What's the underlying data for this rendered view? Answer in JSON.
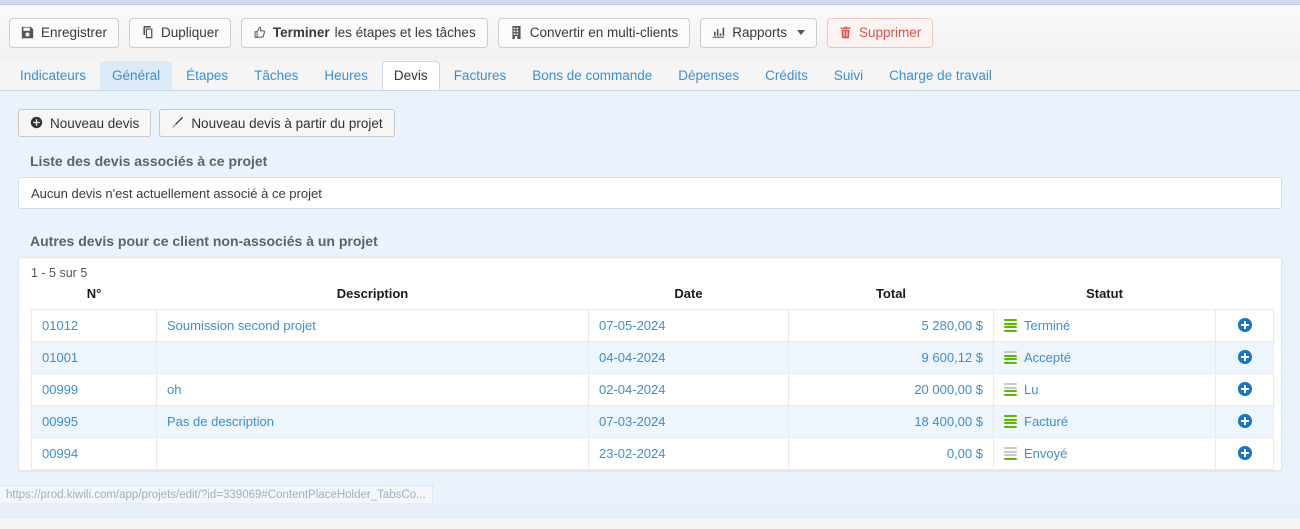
{
  "toolbar": {
    "buttons": [
      {
        "label": "Enregistrer",
        "icon": "save-icon",
        "style": "default"
      },
      {
        "label": "Dupliquer",
        "icon": "copy-icon",
        "style": "default"
      },
      {
        "label": "Terminer",
        "label2": "les étapes et les tâches",
        "icon": "thumbs-up-icon",
        "style": "default"
      },
      {
        "label": "Convertir en multi-clients",
        "icon": "building-icon",
        "style": "default"
      },
      {
        "label": "Rapports",
        "icon": "bar-chart-icon",
        "style": "default",
        "caret": true
      },
      {
        "label": "Supprimer",
        "icon": "trash-icon",
        "style": "danger"
      }
    ]
  },
  "tabs": [
    {
      "label": "Indicateurs",
      "state": "normal"
    },
    {
      "label": "Général",
      "state": "soft"
    },
    {
      "label": "Étapes",
      "state": "normal"
    },
    {
      "label": "Tâches",
      "state": "normal"
    },
    {
      "label": "Heures",
      "state": "normal"
    },
    {
      "label": "Devis",
      "state": "active"
    },
    {
      "label": "Factures",
      "state": "normal"
    },
    {
      "label": "Bons de commande",
      "state": "normal"
    },
    {
      "label": "Dépenses",
      "state": "normal"
    },
    {
      "label": "Crédits",
      "state": "normal"
    },
    {
      "label": "Suivi",
      "state": "normal"
    },
    {
      "label": "Charge de travail",
      "state": "normal"
    }
  ],
  "panel": {
    "actions": [
      {
        "label": "Nouveau devis",
        "icon": "plus-circle-icon"
      },
      {
        "label": "Nouveau devis à partir du projet",
        "icon": "wand-icon"
      }
    ],
    "linked_section_title": "Liste des devis associés à ce projet",
    "linked_empty_message": "Aucun devis n'est actuellement associé à ce projet",
    "other_section_title": "Autres devis pour ce client non-associés à un projet",
    "table": {
      "count_label": "1 - 5 sur 5",
      "columns": [
        "N°",
        "Description",
        "Date",
        "Total",
        "Statut",
        ""
      ],
      "rows": [
        {
          "num": "01012",
          "description": "Soumission second projet",
          "date": "07-05-2024",
          "total": "5 280,00 $",
          "status": "Terminé",
          "progress": 4,
          "action_icon": "add-circle-icon"
        },
        {
          "num": "01001",
          "description": "",
          "date": "04-04-2024",
          "total": "9 600,12 $",
          "status": "Accepté",
          "progress": 3,
          "action_icon": "add-circle-icon"
        },
        {
          "num": "00999",
          "description": "oh",
          "date": "02-04-2024",
          "total": "20 000,00 $",
          "status": "Lu",
          "progress": 2,
          "action_icon": "add-circle-icon"
        },
        {
          "num": "00995",
          "description": "Pas de description",
          "date": "07-03-2024",
          "total": "18 400,00 $",
          "status": "Facturé",
          "progress": 4,
          "action_icon": "add-circle-icon"
        },
        {
          "num": "00994",
          "description": "",
          "date": "23-02-2024",
          "total": "0,00 $",
          "status": "Envoyé",
          "progress": 1,
          "action_icon": "add-circle-icon"
        }
      ]
    }
  },
  "statusbar": {
    "url": "https://prod.kiwili.com/app/projets/edit/?id=339069#ContentPlaceHolder_TabsCo..."
  },
  "colors": {
    "accent_blue": "#3a8fd4",
    "panel_bg": "#eaf2fb",
    "row_alt": "#eef5fc",
    "progress_green": "#5cb800",
    "danger_red": "#d9534f"
  }
}
